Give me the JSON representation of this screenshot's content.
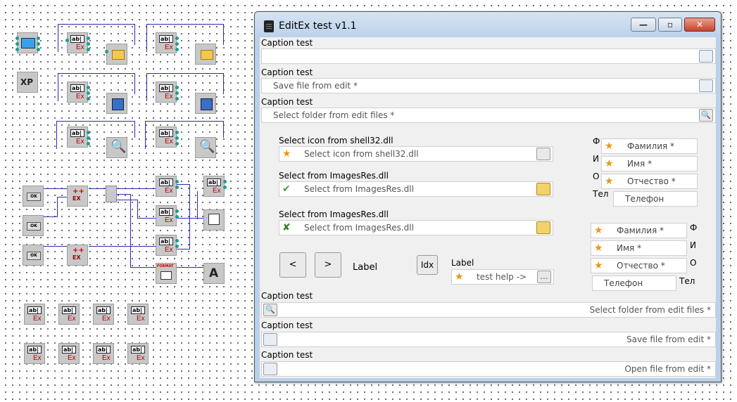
{
  "window": {
    "title": "EditEx test v1.1",
    "minimize": "—",
    "maximize": "▫",
    "close": "✕"
  },
  "canvas": {
    "xp_label": "XP",
    "ok": "OK",
    "edit_icon_text": "ab|",
    "ex": "Ex",
    "plus_text": "++",
    "plus_ex": "EX",
    "format": "FORMAT",
    "label_letter": "A"
  },
  "rows": {
    "open_top": {
      "caption": "Caption test",
      "value": ""
    },
    "save_top": {
      "caption": "Caption test",
      "value": "Save file from edit *"
    },
    "folder_top": {
      "caption": "Caption test",
      "value": "Select folder from edit files *"
    },
    "folder_bottom": {
      "caption": "Caption test",
      "value": "Select folder from edit files *"
    },
    "save_bottom": {
      "caption": "Caption test",
      "value": "Save file from edit *"
    },
    "open_bottom": {
      "caption": "Caption test",
      "value": "Open file from edit *"
    }
  },
  "group": {
    "shell": {
      "label": "Select icon from shell32.dll",
      "value": "Select icon from shell32.dll"
    },
    "images1": {
      "label": "Select from ImagesRes.dll",
      "value": "Select from ImagesRes.dll"
    },
    "images2": {
      "label": "Select from ImagesRes.dll",
      "value": "Select from ImagesRes.dll"
    },
    "prev": "<",
    "next": ">",
    "label1": "Label",
    "idx": "Idx",
    "label2": "Label",
    "help": {
      "value": "test help ->",
      "button": "..."
    }
  },
  "fio_left": {
    "f": {
      "tag": "Ф",
      "value": "Фамилия *"
    },
    "i": {
      "tag": "И",
      "value": "Имя *"
    },
    "o": {
      "tag": "О",
      "value": "Отчество *"
    },
    "t": {
      "tag": "Тел",
      "value": "Телефон"
    }
  },
  "fio_right": {
    "f": {
      "tag": "Ф",
      "value": "Фамилия *"
    },
    "i": {
      "tag": "И",
      "value": "Имя *"
    },
    "o": {
      "tag": "О",
      "value": "Отчество *"
    },
    "t": {
      "tag": "Тел",
      "value": "Телефон"
    }
  },
  "colors": {
    "wire": "#2b2bb0",
    "title_bg": "#bcd1ea",
    "close": "#c8432b",
    "star": "#e79a10"
  }
}
